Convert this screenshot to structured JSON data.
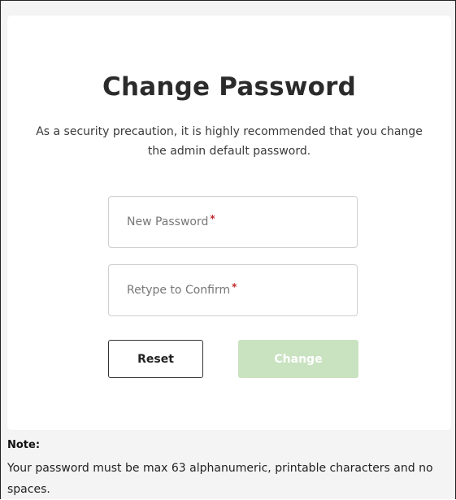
{
  "dialog": {
    "title": "Change Password",
    "description": "As a security precaution, it is highly recommended that you change the admin default password."
  },
  "form": {
    "new_password": {
      "placeholder": "New Password",
      "required_marker": "*"
    },
    "confirm_password": {
      "placeholder": "Retype to Confirm",
      "required_marker": "*"
    }
  },
  "buttons": {
    "reset_label": "Reset",
    "change_label": "Change"
  },
  "note": {
    "heading": "Note:",
    "text": "Your password must be max 63 alphanumeric, printable characters and no spaces."
  },
  "colors": {
    "change_button_disabled": "#c9e2c0",
    "required_marker": "#c0272d"
  }
}
